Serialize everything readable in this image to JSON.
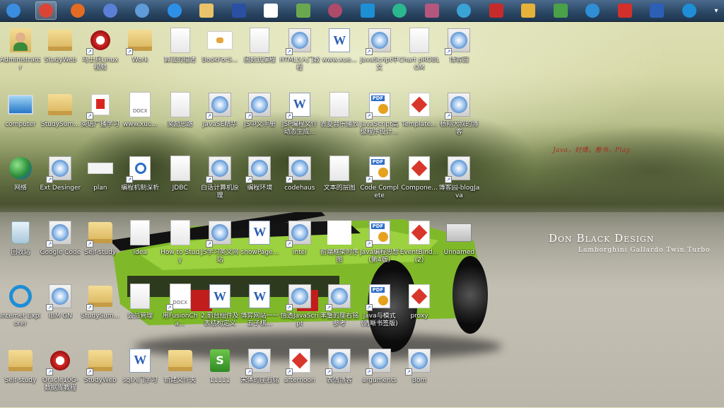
{
  "taskbar": {
    "items": [
      {
        "name": "windows-start-icon",
        "color": "#3b8de0",
        "shape": "circle"
      },
      {
        "name": "chrome-icon",
        "color": "#db4437",
        "shape": "circle"
      },
      {
        "name": "firefox-icon",
        "color": "#e36b22",
        "shape": "circle"
      },
      {
        "name": "globe-icon",
        "color": "#5a7fd6",
        "shape": "circle"
      },
      {
        "name": "safari-icon",
        "color": "#5e9bd8",
        "shape": "circle"
      },
      {
        "name": "update-icon",
        "color": "#2d90e6",
        "shape": "circle"
      },
      {
        "name": "explorer-folder-icon",
        "color": "#e8c36a",
        "shape": "square"
      },
      {
        "name": "app-8-icon",
        "color": "#2a4fa3",
        "shape": "square"
      },
      {
        "name": "fox-icon",
        "color": "#ffffff",
        "shape": "square"
      },
      {
        "name": "vmware-icon",
        "color": "#6aa84f",
        "shape": "square"
      },
      {
        "name": "database-icon",
        "color": "#b04a6a",
        "shape": "circle"
      },
      {
        "name": "webstorm-icon",
        "color": "#1d8fd3",
        "shape": "square"
      },
      {
        "name": "3d-icon",
        "color": "#2bb88f",
        "shape": "circle"
      },
      {
        "name": "database-2-icon",
        "color": "#b5567e",
        "shape": "square"
      },
      {
        "name": "network-tool-icon",
        "color": "#3aa3d6",
        "shape": "circle"
      },
      {
        "name": "star-icon",
        "color": "#c62b2b",
        "shape": "square"
      },
      {
        "name": "grid-app-icon",
        "color": "#e6b23a",
        "shape": "square"
      },
      {
        "name": "chart-app-icon",
        "color": "#4aa14a",
        "shape": "square"
      },
      {
        "name": "bird-icon",
        "color": "#2f8fd6",
        "shape": "circle"
      },
      {
        "name": "mail-m-icon",
        "color": "#d3302b",
        "shape": "square"
      },
      {
        "name": "film-icon",
        "color": "#2d5fb6",
        "shape": "square"
      },
      {
        "name": "ie-taskbar-icon",
        "color": "#1e8ed6",
        "shape": "circle"
      }
    ],
    "overflow": "▾"
  },
  "wallpaper": {
    "brand": "Don Black Design",
    "subtitle": "Lamborghini Gallardo Twin Turbo",
    "signature": "Java，封博，看书，Play"
  },
  "columns": [
    [
      {
        "label": "Administrator",
        "glyph": "user",
        "shortcut": false
      },
      {
        "label": "computer",
        "glyph": "computer",
        "shortcut": false
      },
      {
        "label": "网络",
        "glyph": "network",
        "shortcut": false
      },
      {
        "label": "回收站",
        "glyph": "recycle",
        "shortcut": false
      },
      {
        "label": "Internet Explorer",
        "glyph": "ie",
        "shortcut": false
      },
      {
        "label": "Self-study",
        "glyph": "folder",
        "shortcut": false
      }
    ],
    [
      {
        "label": "StudyWeb",
        "glyph": "folder",
        "shortcut": false
      },
      {
        "label": "StudySum...",
        "glyph": "folder",
        "shortcut": false
      },
      {
        "label": "Ext Desinger",
        "glyph": "safari",
        "shortcut": true
      },
      {
        "label": "Google Code",
        "glyph": "safari",
        "shortcut": true
      },
      {
        "label": "IBM GN",
        "glyph": "safari",
        "shortcut": true
      },
      {
        "label": "Oracle10G-数据库教程",
        "glyph": "player",
        "shortcut": true
      }
    ],
    [
      {
        "label": "马士兵Linux视频",
        "glyph": "player",
        "shortcut": true
      },
      {
        "label": "英语广播学习",
        "glyph": "red",
        "shortcut": true
      },
      {
        "label": "plan",
        "glyph": "plan",
        "shortcut": false
      },
      {
        "label": "Self-study",
        "glyph": "folder",
        "shortcut": true
      },
      {
        "label": "StudySum...",
        "glyph": "folder",
        "shortcut": true
      },
      {
        "label": "StudyWeb",
        "glyph": "folder",
        "shortcut": true
      }
    ],
    [
      {
        "label": "Work",
        "glyph": "folder",
        "shortcut": true
      },
      {
        "label": "www.xuc...",
        "glyph": "docx",
        "shortcut": false
      },
      {
        "label": "编程机制深析",
        "glyph": "code",
        "shortcut": true
      },
      {
        "label": "Idea",
        "glyph": "doc",
        "shortcut": false
      },
      {
        "label": "会员管理",
        "glyph": "doc",
        "shortcut": false
      },
      {
        "label": "sql入门学习",
        "glyph": "word",
        "shortcut": false
      }
    ],
    [
      {
        "label": "算法的描述",
        "glyph": "doc",
        "shortcut": false
      },
      {
        "label": "奖励思路",
        "glyph": "doc",
        "shortcut": false
      },
      {
        "label": "JDBC",
        "glyph": "doc",
        "shortcut": false
      },
      {
        "label": "How to Study",
        "glyph": "doc",
        "shortcut": false
      },
      {
        "label": "用FusionCha...",
        "glyph": "docx",
        "shortcut": true
      },
      {
        "label": "新建文件夹",
        "glyph": "folder",
        "shortcut": false
      }
    ],
    [
      {
        "label": "BookForS...",
        "glyph": "mindmap",
        "shortcut": false
      },
      {
        "label": "JavaSE精华",
        "glyph": "safari",
        "shortcut": true
      },
      {
        "label": "白话计算机原理",
        "glyph": "safari",
        "shortcut": true
      },
      {
        "label": "JS学习英文网站",
        "glyph": "safari",
        "shortcut": true
      },
      {
        "label": "2.前台组件及表结构定义",
        "glyph": "word",
        "shortcut": false
      },
      {
        "label": "11111",
        "glyph": "excel",
        "shortcut": false
      }
    ],
    [
      {
        "label": "函数式编程",
        "glyph": "doc",
        "shortcut": false
      },
      {
        "label": "JS中文手册",
        "glyph": "safari",
        "shortcut": true
      },
      {
        "label": "编程环境",
        "glyph": "safari",
        "shortcut": true
      },
      {
        "label": "showPage...",
        "glyph": "word",
        "shortcut": false
      },
      {
        "label": "博弈网站一一五子棋...",
        "glyph": "word",
        "shortcut": false
      },
      {
        "label": "宋体的座右铭",
        "glyph": "safari",
        "shortcut": true
      }
    ],
    [
      {
        "label": "HTML5入门教程",
        "glyph": "safari",
        "shortcut": true
      },
      {
        "label": "JSP编程文件动态生成...",
        "glyph": "word",
        "shortcut": true
      },
      {
        "label": "codehaus",
        "glyph": "safari",
        "shortcut": true
      },
      {
        "label": "intel",
        "glyph": "safari",
        "shortcut": true
      },
      {
        "label": "悟透JavaScript",
        "glyph": "safari",
        "shortcut": true
      },
      {
        "label": "afternoon",
        "glyph": "ppt",
        "shortcut": true
      }
    ],
    [
      {
        "label": "www.xue...",
        "glyph": "word",
        "shortcut": false
      },
      {
        "label": "青夏音乐播放",
        "glyph": "doc",
        "shortcut": false
      },
      {
        "label": "文本的层图",
        "glyph": "doc",
        "shortcut": false
      },
      {
        "label": "前端框架时序图",
        "glyph": "blank",
        "shortcut": false
      },
      {
        "label": "苯蟹的座右铭参考",
        "glyph": "safari",
        "shortcut": true
      },
      {
        "label": "表情博客",
        "glyph": "safari",
        "shortcut": true
      }
    ],
    [
      {
        "label": "JavaScript中文",
        "glyph": "safari",
        "shortcut": true
      },
      {
        "label": "JavaScript高级程序设计...",
        "glyph": "pdf",
        "shortcut": true
      },
      {
        "label": "Code Complete",
        "glyph": "pdf",
        "shortcut": true
      },
      {
        "label": "Java编程思想(第4版)",
        "glyph": "pdf",
        "shortcut": true
      },
      {
        "label": "Java与模式(清晰书签版)",
        "glyph": "pdf",
        "shortcut": true
      },
      {
        "label": "arguments",
        "glyph": "safari",
        "shortcut": true
      }
    ],
    [
      {
        "label": "Chart pROBLOM",
        "glyph": "doc",
        "shortcut": false
      },
      {
        "label": "Template...",
        "glyph": "ppt",
        "shortcut": false
      },
      {
        "label": "Compone...",
        "glyph": "ppt",
        "shortcut": false
      },
      {
        "label": "EventBind...(2)",
        "glyph": "ppt",
        "shortcut": false
      },
      {
        "label": "proxy",
        "glyph": "ppt",
        "shortcut": false
      },
      {
        "label": "Bom",
        "glyph": "safari",
        "shortcut": true
      }
    ],
    [
      {
        "label": "博客园",
        "glyph": "safari",
        "shortcut": true
      },
      {
        "label": "杨翔大叔的博客",
        "glyph": "safari",
        "shortcut": true
      },
      {
        "label": "博客园-blogJava",
        "glyph": "safari",
        "shortcut": true
      },
      {
        "label": "Unnamed",
        "glyph": "unnamed",
        "shortcut": false
      }
    ]
  ]
}
